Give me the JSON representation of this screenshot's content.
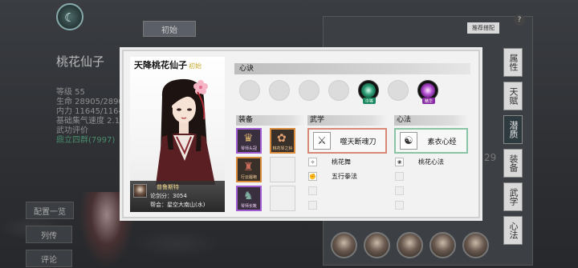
{
  "background": {
    "character_name": "桃花仙子",
    "stats": [
      "等级 55",
      "生命 28905/2890",
      "内力 11645/1164",
      "基础集气速度 2.1",
      "武功评价"
    ],
    "stats_extra": "鼎立四群(7997)",
    "tab_init": "初始",
    "recommend_label": "推荐搭配",
    "help_label": "?",
    "side_tabs": [
      "属性",
      "天赋",
      "潜质",
      "装备",
      "武学",
      "心法"
    ],
    "side_number": "29",
    "left_buttons": [
      "配置一览",
      "列传",
      "评论"
    ]
  },
  "dialog": {
    "title": "天降桃花仙子",
    "title_tag": "初始",
    "info": {
      "player_name": "普鲁斯特",
      "score": "论剑分：3054",
      "guild": "帮会：星空大南山(水)"
    },
    "xinjue": {
      "label": "心诀",
      "badge_green": "中等",
      "badge_purple": "精华"
    },
    "equipment": {
      "label": "装备",
      "slots": [
        {
          "label": "琴师头冠"
        },
        {
          "label": "桃花琴之铃"
        },
        {
          "label": "行云履袍"
        },
        {
          "label": ""
        },
        {
          "label": "琴师长靴"
        },
        {
          "label": ""
        }
      ]
    },
    "wuxue": {
      "label": "武学",
      "main": "噬天断魂刀",
      "skills": [
        "桃花舞",
        "五行拳法",
        "",
        ""
      ]
    },
    "xinfa": {
      "label": "心法",
      "main": "素衣心经",
      "skills": [
        "桃花心法",
        "",
        "",
        ""
      ]
    }
  }
}
